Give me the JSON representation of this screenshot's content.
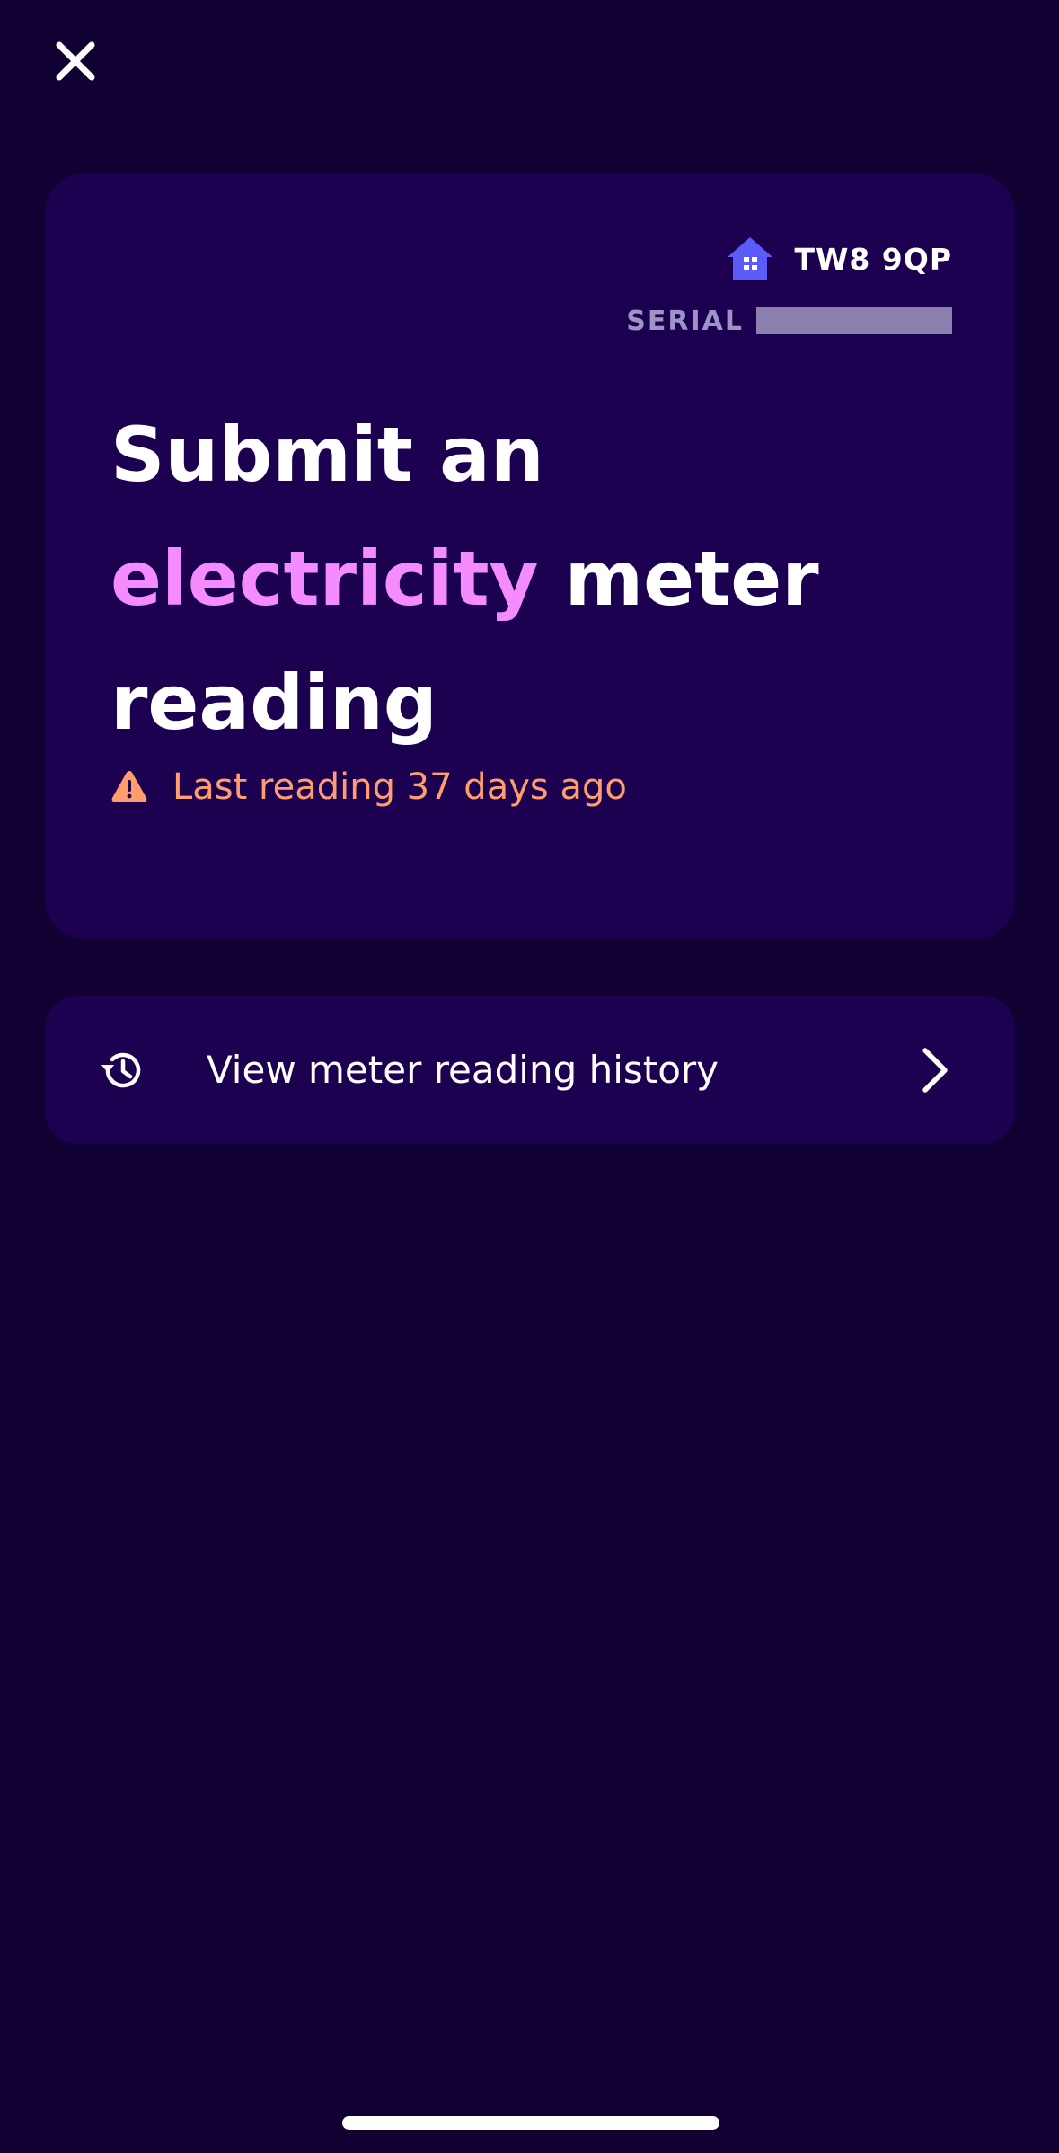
{
  "header": {
    "close_icon": "close-icon"
  },
  "meter_card": {
    "location_icon": "house-icon",
    "postcode": "TW8 9QP",
    "serial_label": "SERIAL",
    "serial_value": "",
    "title_prefix": "Submit an",
    "title_highlight": "electricity",
    "title_suffix": "meter reading",
    "warning_icon": "warning-icon",
    "warning_text": "Last reading 37 days ago"
  },
  "history": {
    "icon": "history-icon",
    "label": "View meter reading history",
    "chevron_icon": "chevron-right-icon"
  },
  "colors": {
    "background": "#110032",
    "card": "#1c0150",
    "accent": "#f48cff",
    "warning": "#ff9d6e",
    "icon_purple": "#5b5bf7",
    "muted": "#9d93c4"
  }
}
